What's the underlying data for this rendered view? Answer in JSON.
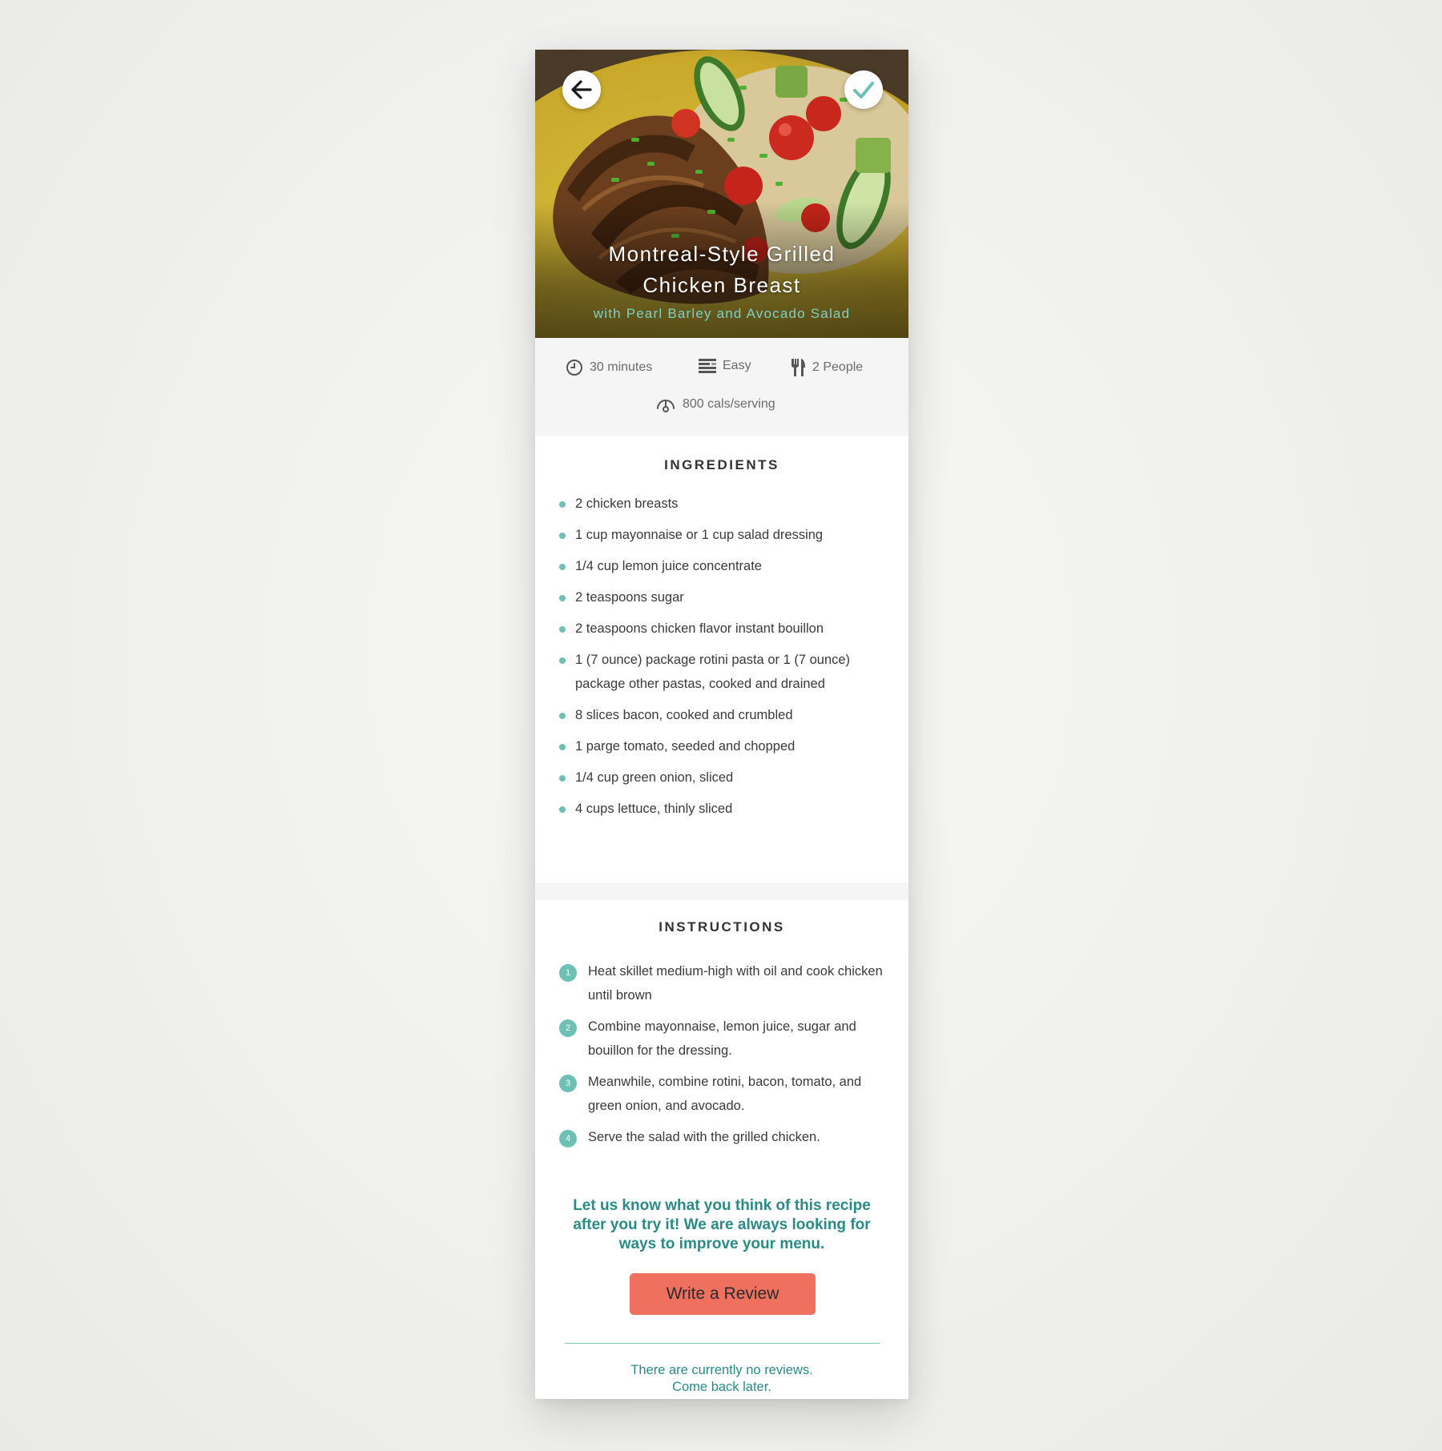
{
  "recipe": {
    "title_line1": "Montreal-Style Grilled",
    "title_line2": "Chicken Breast",
    "subtitle": "with Pearl Barley and Avocado Salad"
  },
  "stats": {
    "time": "30 minutes",
    "difficulty": "Easy",
    "servings": "2 People",
    "calories": "800 cals/serving"
  },
  "ingredients": {
    "title": "INGREDIENTS",
    "items": [
      "2 chicken breasts",
      "1 cup mayonnaise or 1 cup salad dressing",
      "1/4 cup lemon juice concentrate",
      "2 teaspoons sugar",
      "2 teaspoons chicken flavor instant bouillon",
      "1 (7 ounce) package rotini pasta or 1 (7 ounce) package other pastas, cooked and drained",
      "8 slices bacon, cooked and crumbled",
      "1 parge tomato, seeded and chopped",
      "1/4 cup green onion, sliced",
      "4 cups lettuce, thinly sliced"
    ]
  },
  "instructions": {
    "title": "INSTRUCTIONS",
    "steps": [
      {
        "num": "1",
        "text": "Heat skillet medium-high with oil and cook chicken until brown"
      },
      {
        "num": "2",
        "text": "Combine mayonnaise, lemon juice, sugar and bouillon for the dressing."
      },
      {
        "num": "3",
        "text": "Meanwhile, combine rotini, bacon, tomato, and green onion, and avocado."
      },
      {
        "num": "4",
        "text": "Serve the salad with the grilled chicken."
      }
    ]
  },
  "review": {
    "prompt": "Let us know what you think of this recipe after you try it! We are always looking for ways to improve your menu.",
    "button_label": "Write a Review",
    "empty_line1": "There are currently no reviews.",
    "empty_line2": "Come back later."
  },
  "colors": {
    "accent_teal": "#6cc0b4",
    "text_teal": "#2a8a86",
    "button_coral": "#f07060"
  },
  "icons": {
    "back": "arrow-left-icon",
    "done": "checkmark-icon",
    "time": "clock-icon",
    "difficulty": "difficulty-bars-icon",
    "servings": "fork-knife-icon",
    "calories": "gauge-icon"
  }
}
